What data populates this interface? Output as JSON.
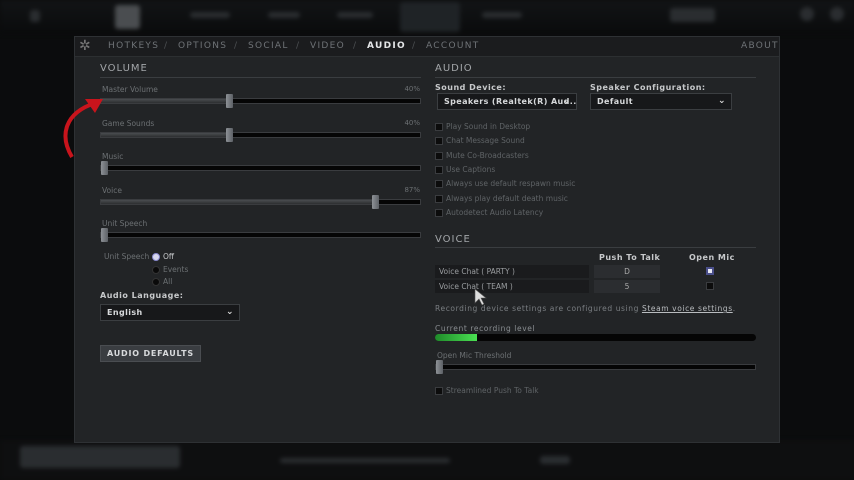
{
  "tabs": [
    {
      "label": "HOTKEYS"
    },
    {
      "label": "OPTIONS"
    },
    {
      "label": "SOCIAL"
    },
    {
      "label": "VIDEO"
    },
    {
      "label": "AUDIO",
      "active": true
    },
    {
      "label": "ACCOUNT"
    }
  ],
  "about_label": "ABOUT",
  "volume": {
    "title": "VOLUME",
    "sliders": [
      {
        "label": "Master Volume",
        "value_text": "40%",
        "value": 40
      },
      {
        "label": "Game Sounds",
        "value_text": "40%",
        "value": 40
      },
      {
        "label": "Music",
        "value_text": "",
        "value": 0
      },
      {
        "label": "Voice",
        "value_text": "87%",
        "value": 87
      },
      {
        "label": "Unit Speech",
        "value_text": "",
        "value": 0
      }
    ],
    "unit_speech_label": "Unit Speech",
    "unit_speech_options": [
      {
        "label": "Off",
        "selected": true
      },
      {
        "label": "Events"
      },
      {
        "label": "All"
      }
    ],
    "audio_language_label": "Audio Language:",
    "audio_language_value": "English",
    "defaults_button": "AUDIO DEFAULTS"
  },
  "audio": {
    "title": "AUDIO",
    "sound_device_label": "Sound Device:",
    "sound_device_value": "Speakers (Realtek(R) Aud...",
    "speaker_config_label": "Speaker Configuration:",
    "speaker_config_value": "Default",
    "checkboxes": [
      {
        "label": "Play Sound in Desktop",
        "checked": false
      },
      {
        "label": "Chat Message Sound",
        "checked": false
      },
      {
        "label": "Mute Co-Broadcasters",
        "checked": false
      },
      {
        "label": "Use Captions",
        "checked": false
      },
      {
        "label": "Always use default respawn music",
        "checked": false
      },
      {
        "label": "Always play default death music",
        "checked": false
      },
      {
        "label": "Autodetect Audio Latency",
        "checked": false
      }
    ]
  },
  "voice": {
    "title": "VOICE",
    "col_push": "Push To Talk",
    "col_open": "Open Mic",
    "rows": [
      {
        "label": "Voice Chat ( PARTY )",
        "key": "D",
        "open_mic": true
      },
      {
        "label": "Voice Chat ( TEAM )",
        "key": "5",
        "open_mic": false
      }
    ],
    "note_prefix": "Recording device settings are configured using ",
    "note_link": "Steam voice settings",
    "note_suffix": ".",
    "recording_label": "Current recording level",
    "recording_level": 13,
    "threshold_label": "Open Mic Threshold",
    "threshold_value": 0,
    "streamlined_label": "Streamlined Push To Talk",
    "streamlined_checked": false
  },
  "colors": {
    "accent_green": "#3fd64a",
    "annotation_arrow": "#c8141c"
  }
}
